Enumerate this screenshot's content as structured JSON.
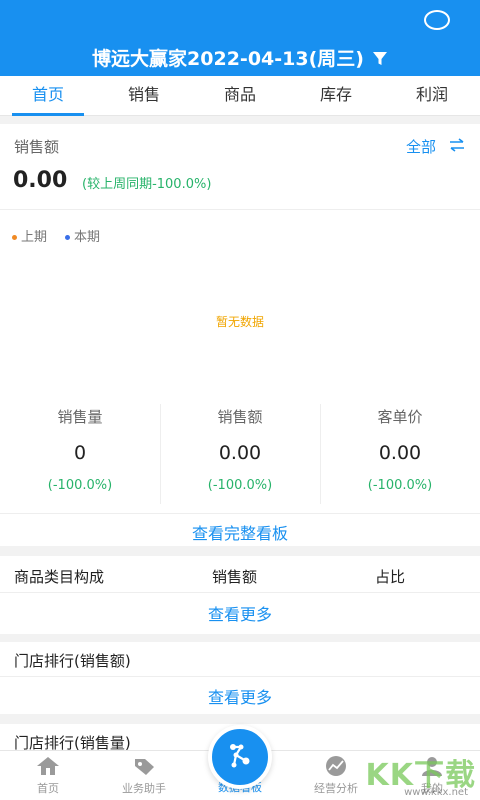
{
  "header": {
    "title": "博远大赢家2022-04-13(周三)"
  },
  "tabs": [
    {
      "label": "首页"
    },
    {
      "label": "销售"
    },
    {
      "label": "商品"
    },
    {
      "label": "库存"
    },
    {
      "label": "利润"
    }
  ],
  "sales": {
    "label": "销售额",
    "all_label": "全部",
    "value": "0.00",
    "compare": "(较上周同期-100.0%)"
  },
  "legend": {
    "prev": "上期",
    "curr": "本期"
  },
  "chart": {
    "empty_text": "暂无数据"
  },
  "metrics": [
    {
      "name": "销售量",
      "value": "0",
      "pct": "(-100.0%)"
    },
    {
      "name": "销售额",
      "value": "0.00",
      "pct": "(-100.0%)"
    },
    {
      "name": "客单价",
      "value": "0.00",
      "pct": "(-100.0%)"
    }
  ],
  "view_full": "查看完整看板",
  "category": {
    "col1": "商品类目构成",
    "col2": "销售额",
    "col3": "占比",
    "more": "查看更多"
  },
  "store_rank_amount": {
    "title": "门店排行(销售额)",
    "more": "查看更多"
  },
  "store_rank_qty": {
    "title": "门店排行(销售量)"
  },
  "bottom_nav": [
    {
      "label": "首页"
    },
    {
      "label": "业务助手"
    },
    {
      "label": "数据看板"
    },
    {
      "label": "经营分析"
    },
    {
      "label": "我的"
    }
  ],
  "watermark": {
    "main": "KK下载",
    "sub": "www.kkx.net"
  },
  "colors": {
    "accent": "#1890f0",
    "positive": "#27b36a",
    "warning": "#f0a500",
    "prev_dot": "#f08a24",
    "curr_dot": "#3a6fe8"
  }
}
